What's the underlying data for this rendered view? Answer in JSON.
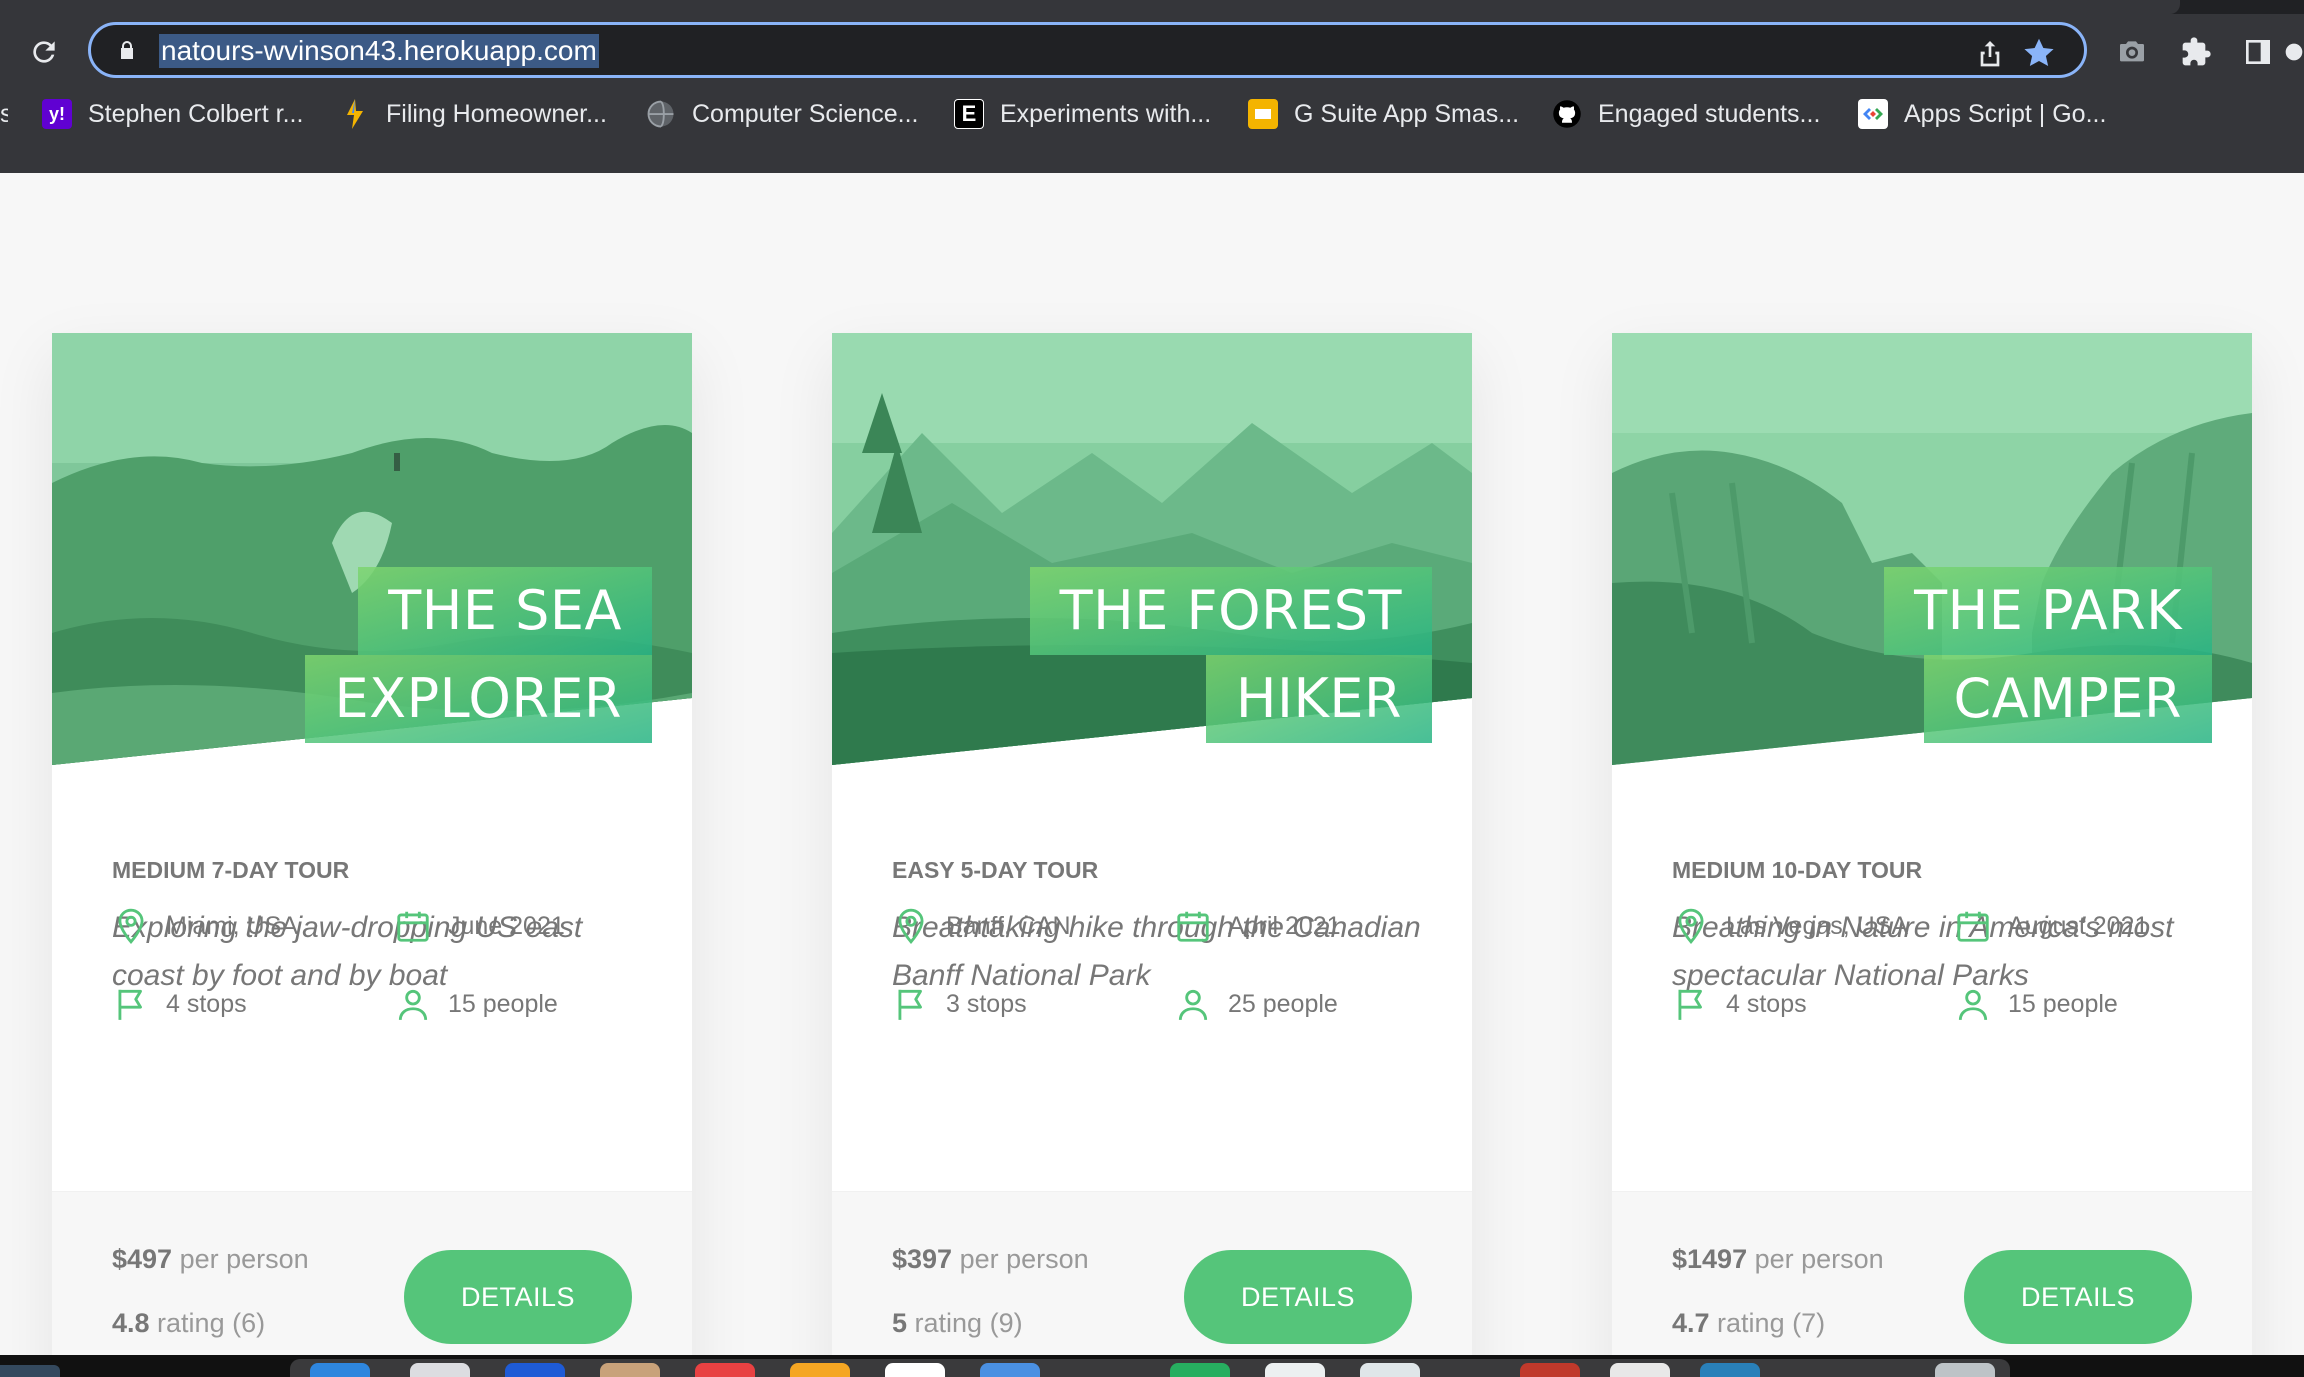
{
  "browser": {
    "url": "natours-wvinson43.herokuapp.com",
    "bookmarks": [
      {
        "label": "Stephen Colbert r...",
        "icon": "yahoo-icon",
        "color": "#6001d2"
      },
      {
        "label": "Filing Homeowner...",
        "icon": "bolt-icon",
        "color": "#f4b400"
      },
      {
        "label": "Computer Science...",
        "icon": "globe-icon",
        "color": "#9aa0a6"
      },
      {
        "label": "Experiments with...",
        "icon": "e-letter-icon",
        "color": "#000000"
      },
      {
        "label": "G Suite App Smas...",
        "icon": "slides-icon",
        "color": "#f4b400"
      },
      {
        "label": "Engaged students...",
        "icon": "github-icon",
        "color": "#000000"
      },
      {
        "label": "Apps Script  |  Go...",
        "icon": "apps-script-icon",
        "color": "#ffffff"
      }
    ],
    "cut_bookmark": "s"
  },
  "tours": [
    {
      "title_line1": "The Sea",
      "title_line2": "Explorer",
      "sub_heading": "Medium 7-day tour",
      "summary": "Exploring the jaw-dropping US east coast by foot and by boat",
      "location": "Miami, USA",
      "date": "June 2021",
      "stops": "4 stops",
      "people": "15 people",
      "price": "$497",
      "price_suffix": " per person",
      "rating": "4.8",
      "rating_suffix": " rating (6)",
      "button": "Details"
    },
    {
      "title_line1": "The Forest",
      "title_line2": "Hiker",
      "sub_heading": "Easy 5-day tour",
      "summary": "Breathtaking hike through the Canadian Banff National Park",
      "location": "Banff, CAN",
      "date": "April 2021",
      "stops": "3 stops",
      "people": "25 people",
      "price": "$397",
      "price_suffix": " per person",
      "rating": "5",
      "rating_suffix": " rating (9)",
      "button": "Details"
    },
    {
      "title_line1": "The Park",
      "title_line2": "Camper",
      "sub_heading": "Medium 10-day tour",
      "summary": "Breathing in Nature in America's most spectacular National Parks",
      "location": "Las Vegas, USA",
      "date": "August 2021",
      "stops": "4 stops",
      "people": "15 people",
      "price": "$1497",
      "price_suffix": " per person",
      "rating": "4.7",
      "rating_suffix": " rating (7)",
      "button": "Details"
    }
  ],
  "colors": {
    "accent": "#55c57a",
    "gradient_light": "#7ed56f",
    "gradient_dark": "#28b485",
    "text_muted": "#777777"
  }
}
